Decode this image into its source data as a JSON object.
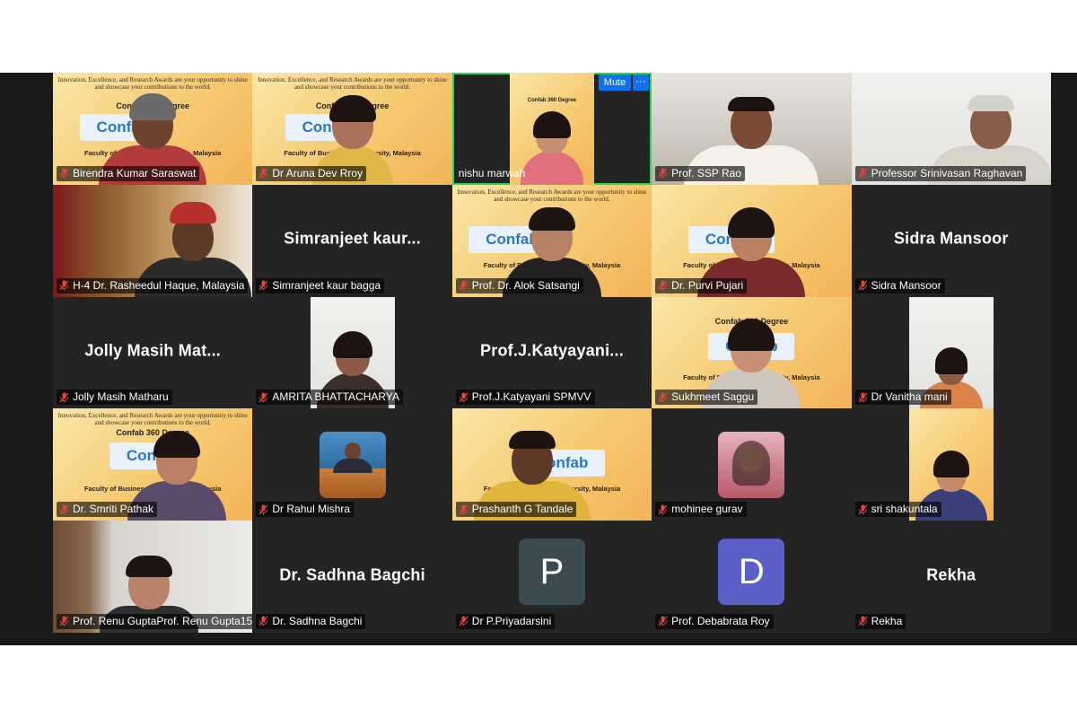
{
  "controls": {
    "mute_label": "Mute",
    "more_label": "···"
  },
  "slide": {
    "header": "Innovation, Excellence, and Research Awards are your opportunity to shine and showcase your contributions to the world.",
    "title": "Confab 360 Degree",
    "logo": "Confab",
    "logo_sub": "360° Degree",
    "footer": "Faculty of Business ... University, Malaysia"
  },
  "participants": [
    {
      "name": "Birendra Kumar Saraswat"
    },
    {
      "name": "Dr Aruna Dev Rroy"
    },
    {
      "name": "nishu marwah"
    },
    {
      "name": "Prof. SSP Rao"
    },
    {
      "name": "Professor Srinivasan Raghavan"
    },
    {
      "name": "H-4 Dr. Rasheedul Haque, Malaysia"
    },
    {
      "name": "Simranjeet kaur bagga",
      "display": "Simranjeet  kaur..."
    },
    {
      "name": "Prof. Dr. Alok Satsangi"
    },
    {
      "name": "Dr. Purvi Pujari"
    },
    {
      "name": "Sidra Mansoor",
      "display": "Sidra Mansoor"
    },
    {
      "name": "Jolly Masih Matharu",
      "display": "Jolly  Masih  Mat..."
    },
    {
      "name": "AMRITA BHATTACHARYA"
    },
    {
      "name": "Prof.J.Katyayani SPMVV",
      "display": "Prof.J.Katyayani..."
    },
    {
      "name": "Sukhmeet Saggu"
    },
    {
      "name": "Dr Vanitha mani"
    },
    {
      "name": "Dr. Smriti Pathak"
    },
    {
      "name": "Dr Rahul Mishra"
    },
    {
      "name": "Prashanth G Tandale"
    },
    {
      "name": "mohinee gurav"
    },
    {
      "name": "sri shakuntala"
    },
    {
      "name": "Prof. Renu GuptaProf. Renu Gupta15..."
    },
    {
      "name": "Dr. Sadhna Bagchi",
      "display": "Dr. Sadhna Bagchi"
    },
    {
      "name": "Dr P.Priyadarsini",
      "initial": "P"
    },
    {
      "name": "Prof. Debabrata Roy",
      "initial": "D"
    },
    {
      "name": "Rekha",
      "display": "Rekha"
    }
  ],
  "colors": {
    "active_speaker_border": "#23d959",
    "button_blue": "#0e72ed",
    "avatar_p": "#3c4a52",
    "avatar_d": "#5b5fc7",
    "mic_muted": "#e0463d"
  },
  "icons": {
    "mic": "mic-muted-icon"
  }
}
